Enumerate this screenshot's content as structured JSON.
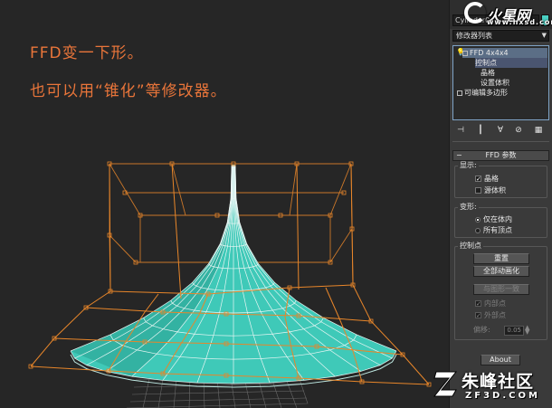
{
  "viewport": {
    "caption1": "FFD变一下形。",
    "caption2": "也可以用“锥化”等修改器。",
    "mesh_color": "#3fc9b8",
    "lattice_color": "#e8862a"
  },
  "panel": {
    "object_name": "Cylinder01",
    "object_color": "#4ad0c3",
    "modifier_list": "修改器列表",
    "stack": {
      "ffd": "FFD 4x4x4",
      "control_points": "控制点",
      "lattice": "晶格",
      "set_volume": "设置体积",
      "editable_poly": "可编辑多边形"
    },
    "rollout_title": "FFD 参数",
    "display": {
      "title": "显示:",
      "lattice": "晶格",
      "source_volume": "源体积"
    },
    "deform": {
      "title": "变形:",
      "inside_volume": "仅在体内",
      "all_vertices": "所有顶点"
    },
    "control_points": {
      "title": "控制点",
      "reset": "重置",
      "animate_all": "全部动画化",
      "conform_to_shape": "与图形一致",
      "inside_points": "内部点",
      "outside_points": "外部点",
      "offset_label": "偏移:",
      "offset_value": "0.05"
    },
    "about": "About"
  },
  "logos": {
    "hxsd_name": "火星网",
    "hxsd_url": "www.hxsd.com",
    "zf_name": "朱峰社区",
    "zf_url": "ZF3D.COM"
  }
}
